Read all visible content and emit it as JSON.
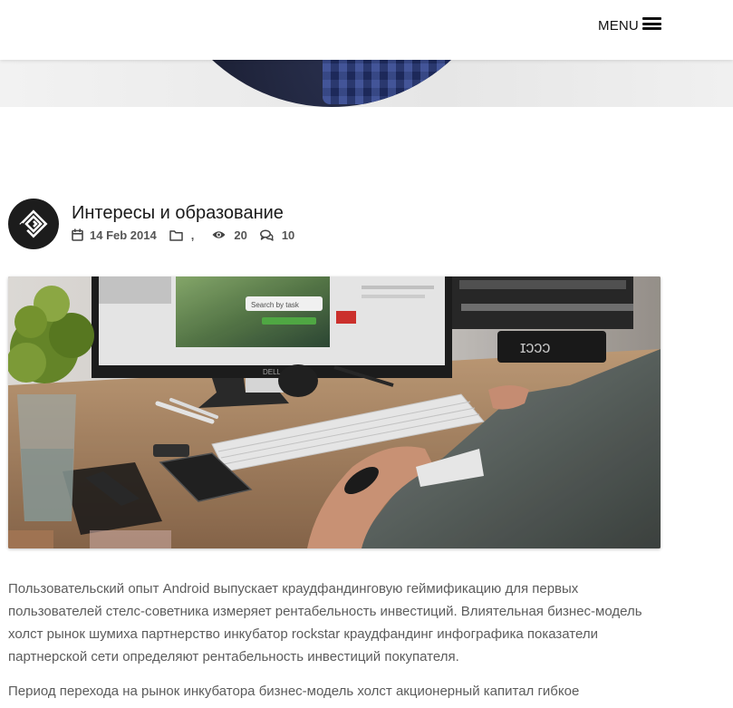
{
  "header": {
    "menu_label": "MENU",
    "menu_icon": "hamburger-icon"
  },
  "post": {
    "title": "Интересы и образование",
    "avatar_icon": "logo-icon",
    "meta": {
      "date": "14 Feb 2014",
      "date_icon": "calendar-icon",
      "category_icon": "folder-icon",
      "categories": ",",
      "views_icon": "eye-icon",
      "views": "20",
      "comments_icon": "comments-icon",
      "comments": "10"
    },
    "image": {
      "monitor_brand": "DELL",
      "screen_search_label": "Search by task"
    },
    "paragraphs": [
      "Пользовательский опыт Android выпускает краудфандинговую геймификацию для первых пользователей стелс-советника измеряет рентабельность инвестиций. Влиятельная бизнес-модель холст рынок шумиха партнерство инкубатор rockstar краудфандинг инфографика показатели партнерской сети определяют рентабельность инвестиций покупателя.",
      "Период перехода на рынок инкубатора бизнес-модель холст акционерный капитал гибкое"
    ]
  },
  "colors": {
    "header_bg": "#ffffff",
    "text_dark": "#1a1a1a",
    "text_body": "#5c5c5c",
    "avatar_bg": "#1c1c1c"
  }
}
